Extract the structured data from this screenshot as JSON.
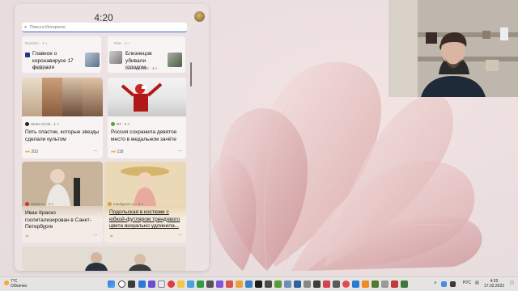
{
  "widgets": {
    "time": "4:20",
    "search_placeholder": "Поиск в Интернете",
    "mini": [
      {
        "source_top": "Rambler · 4 ч",
        "source": "ТАСС · 4 ч",
        "title": "Главное о коронавирусе 17 февраля"
      },
      {
        "source_top": "РБК · 4 ч",
        "source": "Бизнесинсайт · 4 ч",
        "title": "Близнецов убивали голодом"
      }
    ],
    "cards": [
      {
        "source": "Stone Circle · 1 ч",
        "title": "Пять пластик, которые звезды сделали культом",
        "reactions": "203"
      },
      {
        "source": "RT · 4 ч",
        "title": "Россия сохранила девятое место в медальном зачёте",
        "reactions": "118"
      },
      {
        "source": "starhit.ru · 4 ч",
        "title": "Иван Краско госпитализирован в Санкт-Петербурге",
        "reactions": ""
      },
      {
        "source": "tomalgram.ru · 4 ч",
        "title": "Подольская в костюме с юбкой-футляром трендового цвета визуально удлинила...",
        "reactions": ""
      }
    ]
  },
  "taskbar": {
    "weather_temp": "7°C",
    "weather_desc": "Облачно",
    "lang": "РУС",
    "time": "4:20",
    "date": "17.02.2022"
  },
  "colors": {
    "accent": "#2b6fd6",
    "wallpaper": "#ecdfe0",
    "panel": "#ece2e4"
  }
}
